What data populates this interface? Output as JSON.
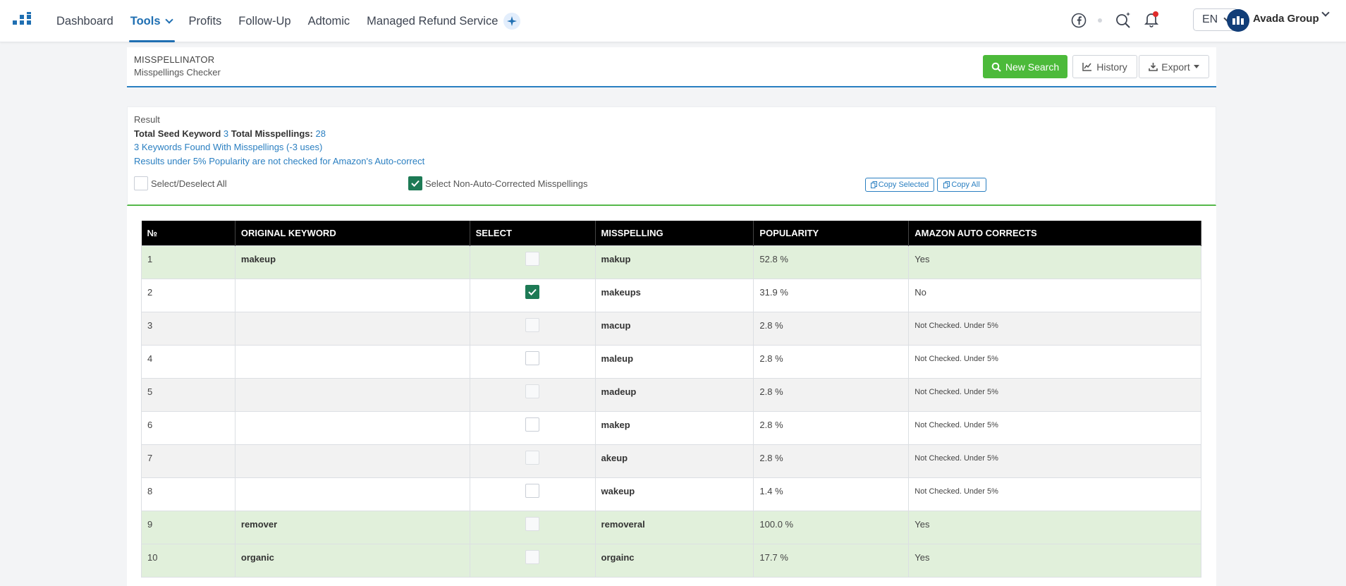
{
  "nav": {
    "logo": "grid-bars-logo",
    "links": [
      {
        "label": "Dashboard"
      },
      {
        "label": "Tools",
        "active": true
      },
      {
        "label": "Profits"
      },
      {
        "label": "Follow-Up"
      },
      {
        "label": "Adtomic"
      },
      {
        "label": "Managed Refund Service"
      }
    ],
    "lang": "EN",
    "user": "Avada Group"
  },
  "header": {
    "title": "MISSPELLINATOR",
    "subtitle": "Misspellings Checker",
    "new_search": "New Search",
    "history": "History",
    "export": "Export"
  },
  "result": {
    "heading": "Result",
    "seed_label": "Total Seed Keyword",
    "seed_count": "3",
    "miss_label": "Total Misspellings:",
    "miss_count": "28",
    "found_text": "3 Keywords Found With Misspellings (-3 uses)",
    "note_text": "Results under 5% Popularity are not checked for Amazon's Auto-correct",
    "select_all": "Select/Deselect All",
    "select_non_auto": "Select Non-Auto-Corrected Misspellings",
    "select_non_auto_checked": true,
    "copy_selected": "Copy Selected",
    "copy_all": "Copy All"
  },
  "table": {
    "headers": [
      "№",
      "ORIGINAL KEYWORD",
      "SELECT",
      "MISSPELLING",
      "POPULARITY",
      "AMAZON AUTO CORRECTS"
    ],
    "rows": [
      {
        "n": "1",
        "keyword": "makeup",
        "checked": false,
        "misspelling": "makup",
        "popularity": "52.8 %",
        "auto": "Yes",
        "style": "green"
      },
      {
        "n": "2",
        "keyword": "",
        "checked": true,
        "misspelling": "makeups",
        "popularity": "31.9 %",
        "auto": "No",
        "style": "white"
      },
      {
        "n": "3",
        "keyword": "",
        "checked": false,
        "misspelling": "macup",
        "popularity": "2.8 %",
        "auto": "Not Checked. Under 5%",
        "style": "gray"
      },
      {
        "n": "4",
        "keyword": "",
        "checked": false,
        "misspelling": "maleup",
        "popularity": "2.8 %",
        "auto": "Not Checked. Under 5%",
        "style": "white"
      },
      {
        "n": "5",
        "keyword": "",
        "checked": false,
        "misspelling": "madeup",
        "popularity": "2.8 %",
        "auto": "Not Checked. Under 5%",
        "style": "gray"
      },
      {
        "n": "6",
        "keyword": "",
        "checked": false,
        "misspelling": "makep",
        "popularity": "2.8 %",
        "auto": "Not Checked. Under 5%",
        "style": "white"
      },
      {
        "n": "7",
        "keyword": "",
        "checked": false,
        "misspelling": "akeup",
        "popularity": "2.8 %",
        "auto": "Not Checked. Under 5%",
        "style": "gray"
      },
      {
        "n": "8",
        "keyword": "",
        "checked": false,
        "misspelling": "wakeup",
        "popularity": "1.4 %",
        "auto": "Not Checked. Under 5%",
        "style": "white"
      },
      {
        "n": "9",
        "keyword": "remover",
        "checked": false,
        "misspelling": "removeral",
        "popularity": "100.0 %",
        "auto": "Yes",
        "style": "green"
      },
      {
        "n": "10",
        "keyword": "organic",
        "checked": false,
        "misspelling": "orgainc",
        "popularity": "17.7 %",
        "auto": "Yes",
        "style": "green"
      }
    ]
  }
}
